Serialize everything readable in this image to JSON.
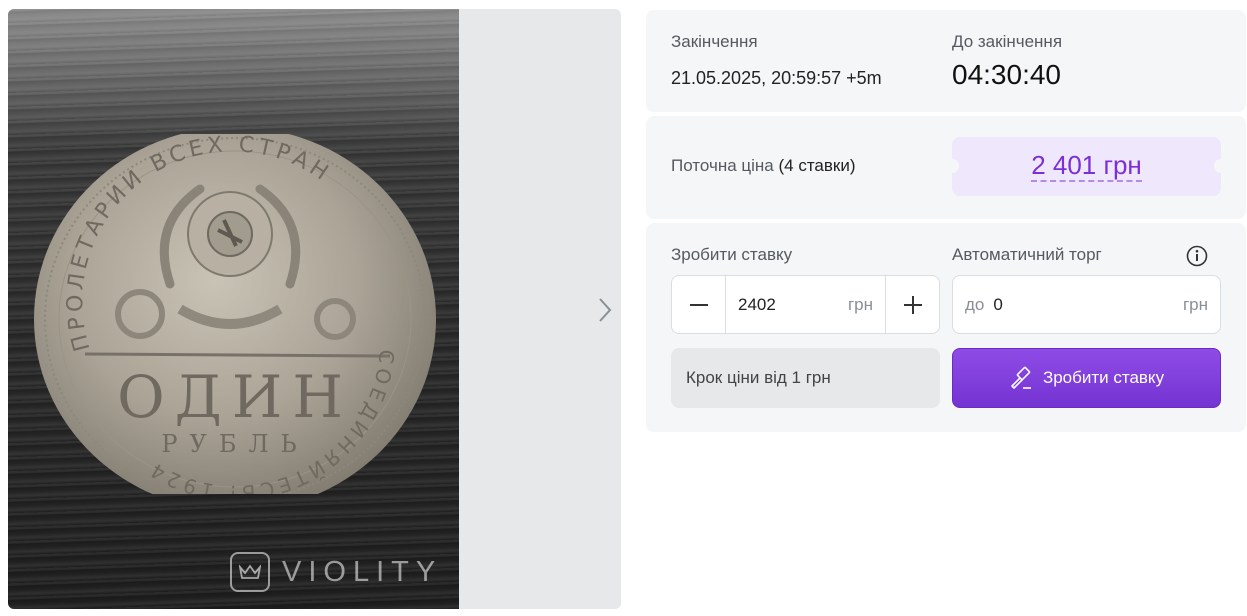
{
  "gallery": {
    "watermark_text": "VIOLITY",
    "coin_text_top": "ПРОЛЕТАРИИ ВСЕХ СТРАН",
    "coin_text_bottom": "СОЕДИНЯЙТЕСЬ! 1924",
    "coin_denomination": "ОДИН",
    "coin_unit": "РУБЛЬ",
    "next_icon": "chevron-right-icon"
  },
  "ending": {
    "label": "Закінчення",
    "value": "21.05.2025, 20:59:57 +5m",
    "countdown_label": "До закінчення",
    "countdown_value": "04:30:40"
  },
  "price": {
    "label": "Поточна ціна",
    "bids_count": "(4 ставки)",
    "value": "2 401 грн"
  },
  "bid": {
    "label": "Зробити ставку",
    "minus_symbol": "—",
    "plus_symbol": "+",
    "amount_value": "2402",
    "amount_unit": "грн",
    "auto_label": "Автоматичний торг",
    "auto_prefix": "до",
    "auto_value": "0",
    "auto_unit": "грн",
    "step_note": "Крок ціни від 1 грн",
    "button_label": "Зробити ставку",
    "button_icon": "gavel-icon",
    "info_icon": "info-icon"
  },
  "colors": {
    "accent": "#7b2fd6",
    "price_badge_bg": "#efe7fb",
    "card_bg": "#f5f6f7"
  }
}
